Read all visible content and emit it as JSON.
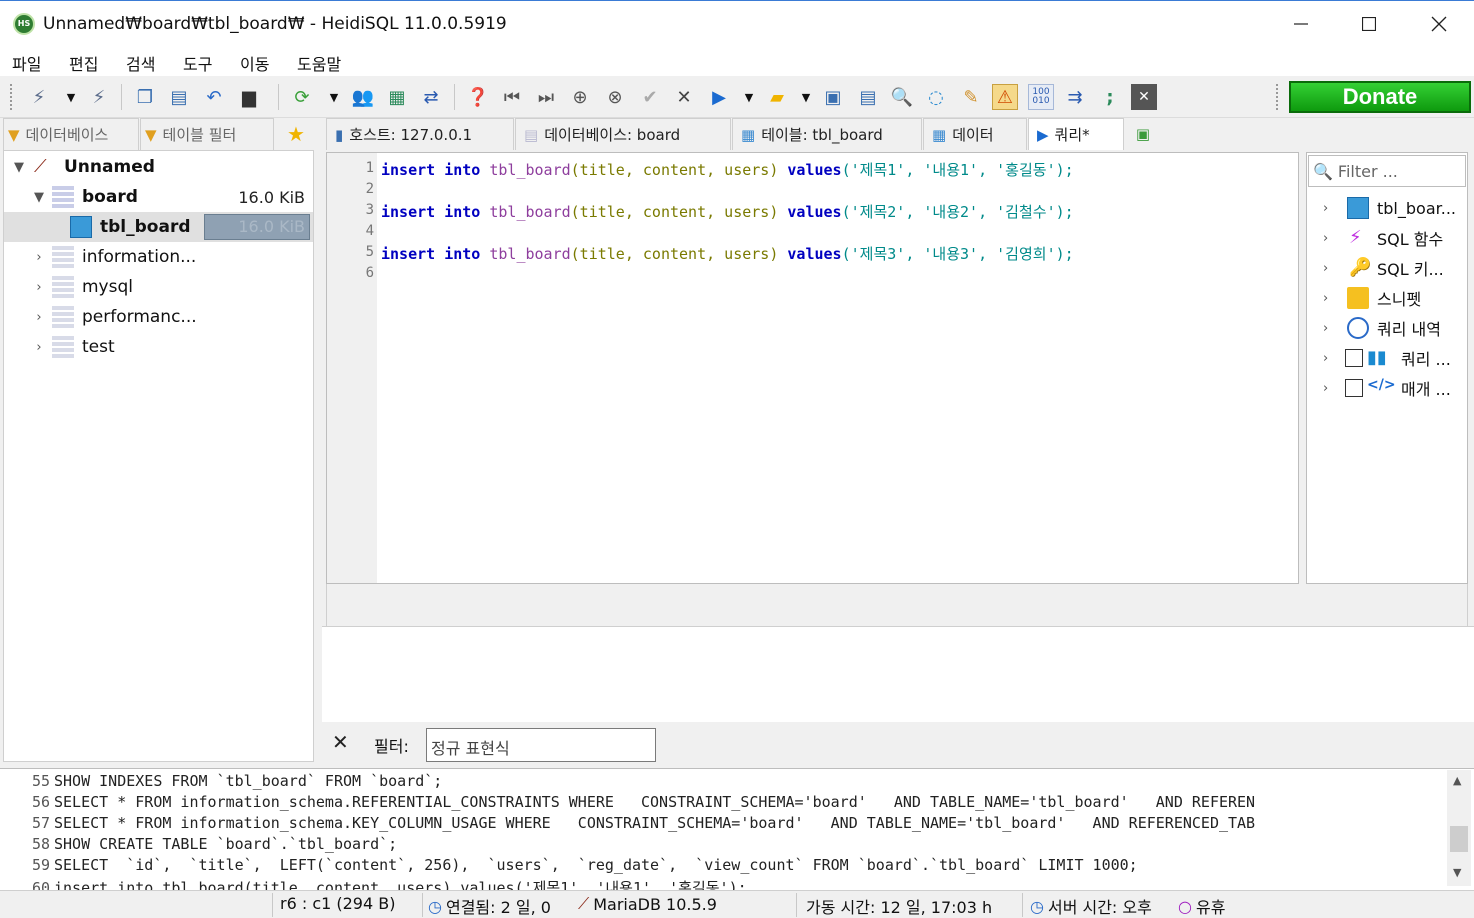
{
  "window": {
    "title": "Unnamed₩board₩tbl_board₩ - HeidiSQL 11.0.0.5919",
    "app_icon_text": "HS"
  },
  "menu": [
    "파일",
    "편집",
    "검색",
    "도구",
    "이동",
    "도움말"
  ],
  "toolbar": {
    "donate_label": "Donate"
  },
  "left_tabs": {
    "database_filter": "데이터베이스",
    "table_filter": "테이블 필터"
  },
  "tabs": {
    "host": "호스트: 127.0.0.1",
    "database": "데이터베이스: board",
    "table": "테이블: tbl_board",
    "data": "데이터",
    "query": "쿼리*"
  },
  "tree": {
    "root": "Unnamed",
    "items": [
      {
        "label": "board",
        "size": "16.0 KiB"
      },
      {
        "label": "tbl_board",
        "size": "16.0 KiB"
      },
      {
        "label": "information..."
      },
      {
        "label": "mysql"
      },
      {
        "label": "performanc..."
      },
      {
        "label": "test"
      }
    ]
  },
  "editor": {
    "line_numbers": [
      "1",
      "2",
      "3",
      "4",
      "5",
      "6"
    ],
    "lines": [
      {
        "kw1": "insert",
        "kw2": "into",
        "table": "tbl_board",
        "cols": "(title, content, users)",
        "kw3": "values",
        "vals": "('제목1', '내용1', '홍길동');"
      },
      null,
      {
        "kw1": "insert",
        "kw2": "into",
        "table": "tbl_board",
        "cols": "(title, content, users)",
        "kw3": "values",
        "vals": "('제목2', '내용2', '김철수');"
      },
      null,
      {
        "kw1": "insert",
        "kw2": "into",
        "table": "tbl_board",
        "cols": "(title, content, users)",
        "kw3": "values",
        "vals": "('제목3', '내용3', '김영희');"
      }
    ]
  },
  "helpers": {
    "filter_placeholder": "Filter ...",
    "items": [
      "tbl_boar...",
      "SQL 함수",
      "SQL 키...",
      "스니펫",
      "쿼리 내역",
      "쿼리 ...",
      "매개 ..."
    ]
  },
  "filter": {
    "label": "필터:",
    "placeholder": "정규 표현식"
  },
  "log": [
    {
      "n": "55",
      "text": "SHOW INDEXES FROM `tbl_board` FROM `board`;"
    },
    {
      "n": "56",
      "text": "SELECT * FROM information_schema.REFERENTIAL_CONSTRAINTS WHERE   CONSTRAINT_SCHEMA='board'   AND TABLE_NAME='tbl_board'   AND REFEREN"
    },
    {
      "n": "57",
      "text": "SELECT * FROM information_schema.KEY_COLUMN_USAGE WHERE   CONSTRAINT_SCHEMA='board'   AND TABLE_NAME='tbl_board'   AND REFERENCED_TAB"
    },
    {
      "n": "58",
      "text": "SHOW CREATE TABLE `board`.`tbl_board`;"
    },
    {
      "n": "59",
      "text": "SELECT  `id`,  `title`,  LEFT(`content`, 256),  `users`,  `reg_date`,  `view_count` FROM `board`.`tbl_board` LIMIT 1000;"
    },
    {
      "n": "60",
      "text": "insert into tbl_board(title, content, users) values('제목1', '내용1', '홍길동');"
    }
  ],
  "status": {
    "cursor": "r6 : c1 (294 B)",
    "connected": "연결됨: 2 일, 0",
    "server": "MariaDB 10.5.9",
    "uptime": "가동 시간: 12 일, 17:03 h",
    "server_time": "서버 시간: 오후",
    "idle": "유휴"
  },
  "colors": {
    "keyword": "#0000c0",
    "table": "#8e3e9d",
    "string": "#008a8a",
    "donate": "#1aa81a"
  }
}
